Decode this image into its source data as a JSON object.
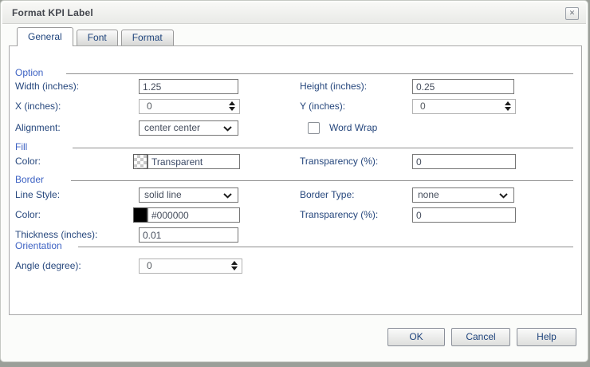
{
  "window": {
    "title": "Format KPI Label",
    "close_icon": "✕"
  },
  "tabs": [
    {
      "label": "General",
      "active": true
    },
    {
      "label": "Font",
      "active": false
    },
    {
      "label": "Format",
      "active": false
    }
  ],
  "option": {
    "header": "Option",
    "width_label": "Width (inches):",
    "width_value": "1.25",
    "height_label": "Height (inches):",
    "height_value": "0.25",
    "x_label": "X (inches):",
    "x_value": "0",
    "y_label": "Y (inches):",
    "y_value": "0",
    "alignment_label": "Alignment:",
    "alignment_value": "center center",
    "word_wrap_label": "Word Wrap",
    "word_wrap_checked": false
  },
  "fill": {
    "header": "Fill",
    "color_label": "Color:",
    "color_value": "Transparent",
    "color_swatch": "transparent",
    "transparency_label": "Transparency (%):",
    "transparency_value": "0"
  },
  "border": {
    "header": "Border",
    "line_style_label": "Line Style:",
    "line_style_value": "solid line",
    "border_type_label": "Border Type:",
    "border_type_value": "none",
    "color_label": "Color:",
    "color_value": "#000000",
    "color_swatch": "#000000",
    "transparency_label": "Transparency (%):",
    "transparency_value": "0",
    "thickness_label": "Thickness (inches):",
    "thickness_value": "0.01"
  },
  "orientation": {
    "header": "Orientation",
    "angle_label": "Angle (degree):",
    "angle_value": "0"
  },
  "buttons": {
    "ok": "OK",
    "cancel": "Cancel",
    "help": "Help"
  },
  "colors": {
    "label": "#26477d",
    "section_header": "#3d62c3",
    "border_color_swatch": "#000000"
  }
}
